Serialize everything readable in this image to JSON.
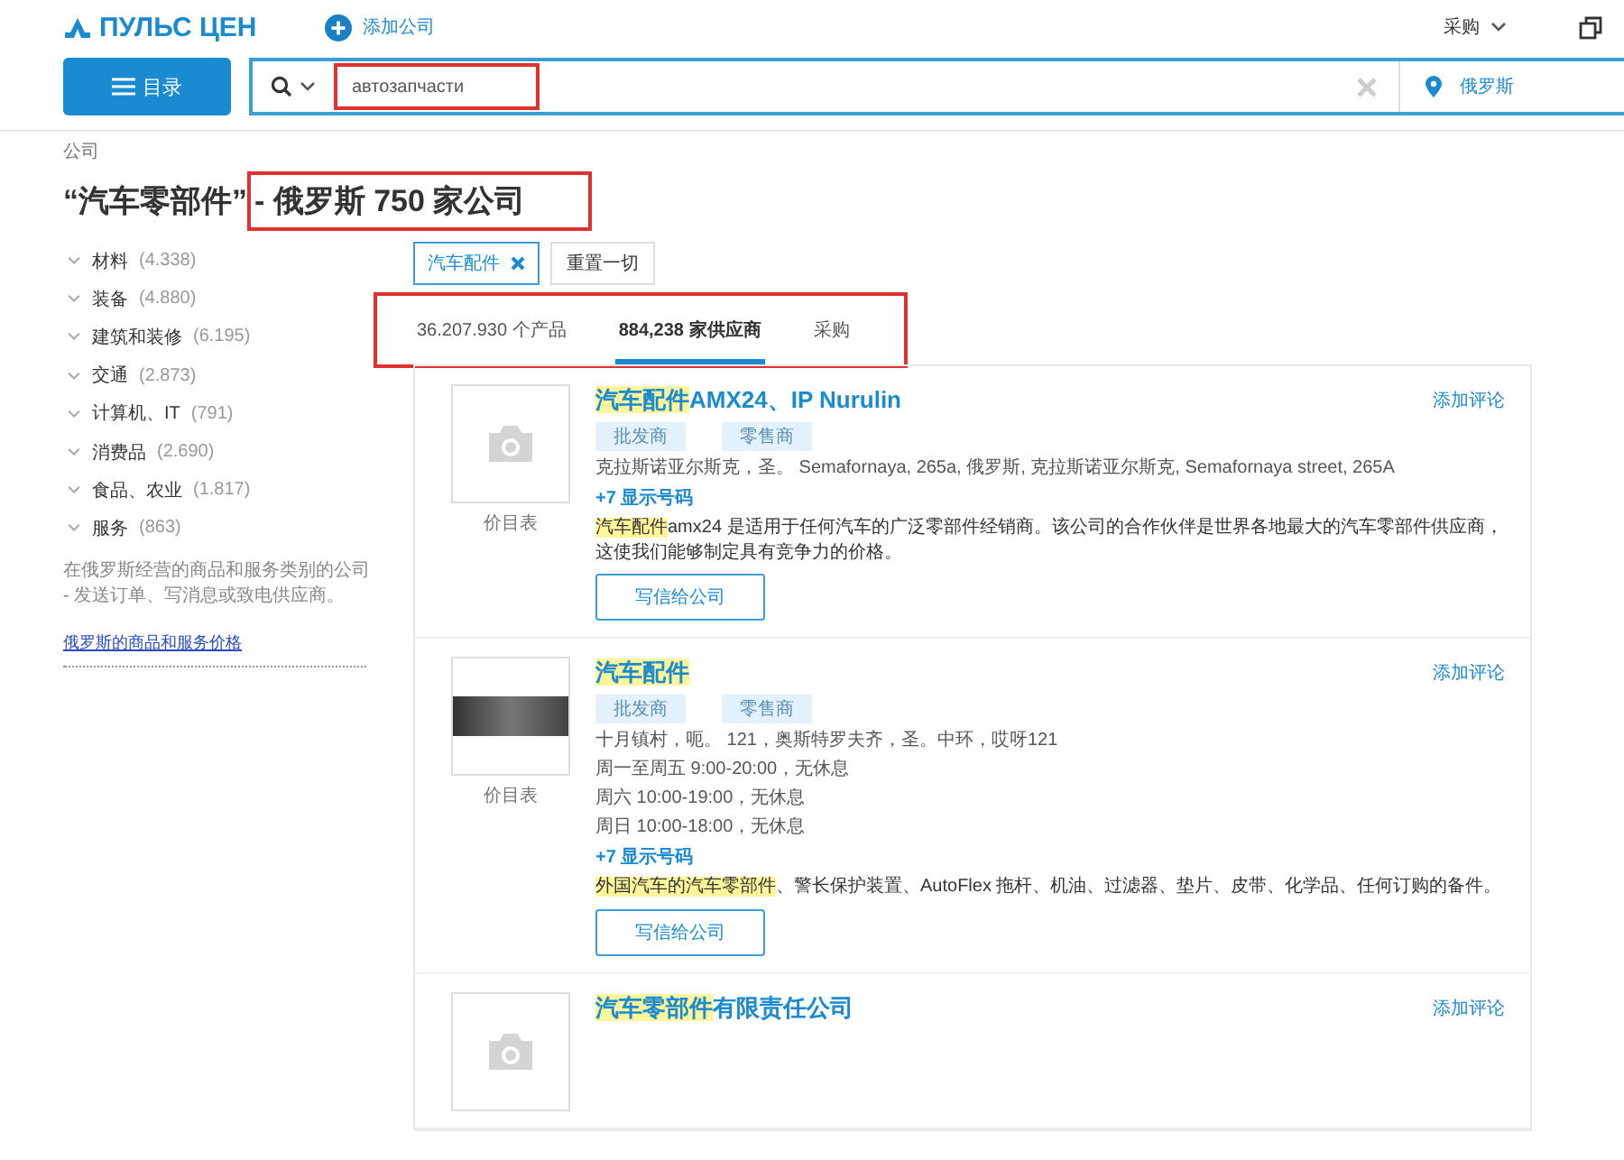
{
  "header": {
    "logo": "ПУЛЬС ЦЕН",
    "add_company": "添加公司",
    "purchase_menu": "采购"
  },
  "search": {
    "catalog_button": "目录",
    "value": "автозапчасти",
    "annotated": true,
    "region": "俄罗斯"
  },
  "breadcrumb": "公司",
  "title": {
    "query": "“汽车零部件”",
    "count": "- 俄罗斯 750 家公司",
    "annotated": true
  },
  "sidebar": {
    "categories": [
      {
        "label": "材料",
        "count": "(4.338)"
      },
      {
        "label": "装备",
        "count": "(4.880)"
      },
      {
        "label": "建筑和装修",
        "count": "(6.195)"
      },
      {
        "label": "交通",
        "count": "(2.873)"
      },
      {
        "label": "计算机、IT",
        "count": "(791)"
      },
      {
        "label": "消费品",
        "count": "(2.690)"
      },
      {
        "label": "食品、农业",
        "count": "(1.817)"
      },
      {
        "label": "服务",
        "count": "(863)"
      }
    ],
    "note": "在俄罗斯经营的商品和服务类别的公司 - 发送订单、写消息或致电供应商。",
    "link": "俄罗斯的商品和服务价格"
  },
  "filters": {
    "chips": [
      "汽车配件"
    ],
    "reset": "重置一切"
  },
  "tabs": {
    "annotated": true,
    "items": [
      {
        "label": "36.207.930 个产品",
        "selected": false
      },
      {
        "label": "884,238 家供应商",
        "selected": true
      },
      {
        "label": "采购",
        "selected": false
      }
    ]
  },
  "companies": [
    {
      "kind": "placeholder",
      "image_caption": "价目表",
      "title_highlight": "汽车配件",
      "title_rest": "AMX24、IP Nurulin",
      "review": "添加评论",
      "tags": [
        "批发商",
        "零售商"
      ],
      "details": [
        "克拉斯诺亚尔斯克，圣。 Semafornaya, 265a, 俄罗斯, 克拉斯诺亚尔斯克, Semafornaya street, 265A"
      ],
      "phone": "+7 显示号码",
      "desc_highlight": "汽车配件",
      "desc_rest": "amx24 是适用于任何汽车的广泛零部件经销商。该公司的合作伙伴是世界各地最大的汽车零部件供应商，这使我们能够制定具有竞争力的价格。",
      "write_button": "写信给公司"
    },
    {
      "kind": "photo",
      "image_caption": "价目表",
      "title_highlight": "汽车配件",
      "review": "添加评论",
      "tags": [
        "批发商",
        "零售商"
      ],
      "details": [
        "十月镇村，呃。 121，奥斯特罗夫齐，圣。中环，哎呀121",
        "周一至周五 9:00-20:00，无休息",
        "周六 10:00-19:00，无休息",
        "周日 10:00-18:00，无休息"
      ],
      "phone": "+7 显示号码",
      "desc_highlight": "外国汽车的汽车零部件",
      "desc_rest": "、警长保护装置、AutoFlex 拖杆、机油、过滤器、垫片、皮带、化学品、任何订购的备件。",
      "write_button": "写信给公司"
    },
    {
      "kind": "placeholder",
      "title_highlight": "汽车零部件",
      "title_rest": "有限责任公司",
      "review": "添加评论"
    }
  ]
}
